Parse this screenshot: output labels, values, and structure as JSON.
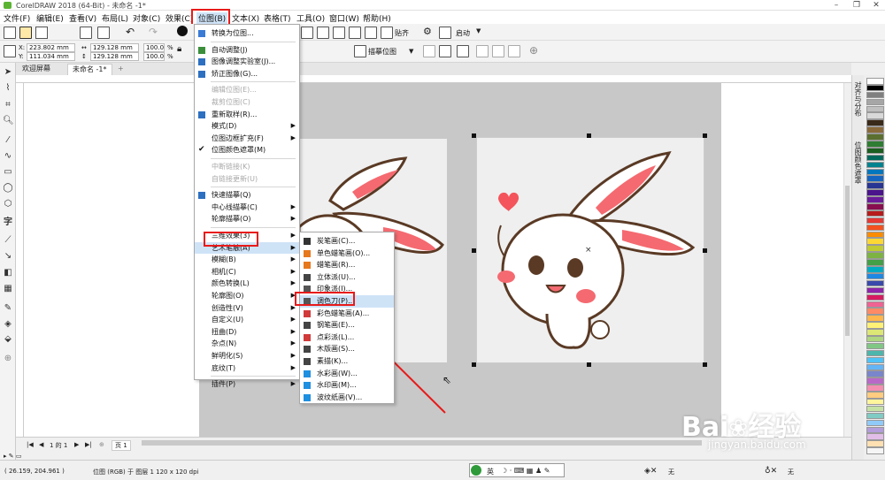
{
  "window": {
    "title": "CorelDRAW 2018 (64-Bit) - 未命名 -1*",
    "controls": [
      "–",
      "❐",
      "✕"
    ]
  },
  "menubar": [
    "文件(F)",
    "编辑(E)",
    "查看(V)",
    "布局(L)",
    "对象(C)",
    "效果(C)",
    "位图(B)",
    "文本(X)",
    "表格(T)",
    "工具(O)",
    "窗口(W)",
    "帮助(H)"
  ],
  "toolbar": {
    "snap_label": "贴齐",
    "launch_label": "启动",
    "trace_label": "描摹位图"
  },
  "propbar": {
    "x": "223.802 mm",
    "y": "111.034 mm",
    "w": "129.128 mm",
    "h": "129.128 mm",
    "sx": "100.0",
    "sy": "100.0",
    "pct": "%",
    "x_lbl": "X:",
    "y_lbl": "Y:"
  },
  "tabs": {
    "welcome": "欢迎屏幕",
    "doc": "未命名 -1*",
    "add": "+"
  },
  "bitmap_menu": [
    {
      "label": "转换为位图...",
      "icon": "#3a7bd5"
    },
    {
      "sep": true
    },
    {
      "label": "自动调整(J)",
      "icon": "#3b8f3b"
    },
    {
      "label": "图像调整实验室(J)...",
      "icon": "#2d6fc0"
    },
    {
      "label": "矫正图像(G)...",
      "icon": "#2d6fc0"
    },
    {
      "sep": true
    },
    {
      "label": "编辑位图(E)...",
      "disabled": true
    },
    {
      "label": "裁剪位图(C)",
      "disabled": true
    },
    {
      "label": "重新取样(R)...",
      "icon": "#2d6fc0"
    },
    {
      "label": "模式(D)",
      "arrow": true
    },
    {
      "label": "位图边框扩充(F)",
      "arrow": true
    },
    {
      "label": "位图颜色遮罩(M)",
      "check": true
    },
    {
      "sep": true
    },
    {
      "label": "中断链接(K)",
      "disabled": true
    },
    {
      "label": "自链接更新(U)",
      "disabled": true
    },
    {
      "sep": true
    },
    {
      "label": "快速描摹(Q)",
      "icon": "#2d6fc0"
    },
    {
      "label": "中心线描摹(C)",
      "arrow": true
    },
    {
      "label": "轮廓描摹(O)",
      "arrow": true
    },
    {
      "sep": true
    },
    {
      "label": "三维效果(3)",
      "arrow": true
    },
    {
      "label": "艺术笔触(A)",
      "arrow": true,
      "highlight": true
    },
    {
      "label": "模糊(B)",
      "arrow": true
    },
    {
      "label": "相机(C)",
      "arrow": true
    },
    {
      "label": "颜色转换(L)",
      "arrow": true
    },
    {
      "label": "轮廓图(O)",
      "arrow": true
    },
    {
      "label": "创造性(V)",
      "arrow": true
    },
    {
      "label": "自定义(U)",
      "arrow": true
    },
    {
      "label": "扭曲(D)",
      "arrow": true
    },
    {
      "label": "杂点(N)",
      "arrow": true
    },
    {
      "label": "鲜明化(S)",
      "arrow": true
    },
    {
      "label": "底纹(T)",
      "arrow": true
    },
    {
      "sep": true
    },
    {
      "label": "插件(P)",
      "arrow": true
    }
  ],
  "art_submenu": [
    {
      "label": "炭笔画(C)...",
      "icon": "#333333"
    },
    {
      "label": "单色蜡笔画(O)...",
      "icon": "#e6781e"
    },
    {
      "label": "蜡笔画(R)...",
      "icon": "#e6781e"
    },
    {
      "label": "立体派(U)...",
      "icon": "#444444"
    },
    {
      "label": "印象派(I)...",
      "icon": "#555555"
    },
    {
      "label": "调色刀(P)...",
      "icon": "#555555",
      "highlight": true
    },
    {
      "label": "彩色蜡笔画(A)...",
      "icon": "#d03a3a"
    },
    {
      "label": "钢笔画(E)...",
      "icon": "#444444"
    },
    {
      "label": "点彩派(L)...",
      "icon": "#d03a3a"
    },
    {
      "label": "木版画(S)...",
      "icon": "#444444"
    },
    {
      "label": "素描(K)...",
      "icon": "#444444"
    },
    {
      "label": "水彩画(W)...",
      "icon": "#1f8fe0"
    },
    {
      "label": "水印画(M)...",
      "icon": "#1f8fe0"
    },
    {
      "label": "波纹纸画(V)...",
      "icon": "#1f8fe0"
    }
  ],
  "pages": {
    "nav": "1 的 1",
    "page_tab": "页 1"
  },
  "status": {
    "coords": "( 26.159, 204.961 )",
    "layer_info": "位图 (RGB) 于 图层 1 120 x 120 dpi",
    "fill_none": "无",
    "outline_none": "无"
  },
  "ime": {
    "label": "英"
  },
  "dockers": {
    "align": "对齐与分布",
    "mask": "位图颜色遮罩"
  },
  "watermark": {
    "brand": "Bai",
    "brand2": "经验",
    "url": "jingyan.baidu.com"
  },
  "palette_colors": [
    "#ffffff",
    "#000000",
    "#7f7f7f",
    "#a6a6a6",
    "#bfbfbf",
    "#d9d9d9",
    "#3a2a1a",
    "#8a6a3a",
    "#5b6f2f",
    "#2e7d32",
    "#1b5e20",
    "#00695c",
    "#00838f",
    "#0277bd",
    "#1565c0",
    "#283593",
    "#4a148c",
    "#6a1b9a",
    "#880e4f",
    "#b71c1c",
    "#e53935",
    "#f4511e",
    "#fb8c00",
    "#fdd835",
    "#c0ca33",
    "#7cb342",
    "#43a047",
    "#00acc1",
    "#1e88e5",
    "#3949ab",
    "#8e24aa",
    "#d81b60",
    "#f06292",
    "#ff8a65",
    "#ffb74d",
    "#fff176",
    "#dce775",
    "#aed581",
    "#81c784",
    "#4db6ac",
    "#4fc3f7",
    "#64b5f6",
    "#7986cb",
    "#ba68c8",
    "#f48fb1",
    "#ffcc80",
    "#fff59d",
    "#c5e1a5",
    "#80cbc4",
    "#90caf9",
    "#b39ddb",
    "#e1bee7",
    "#ffe0b2",
    "#f5f5f5"
  ],
  "accent": {
    "red": "#e81a1a",
    "highlight": "#cfe3f7"
  }
}
